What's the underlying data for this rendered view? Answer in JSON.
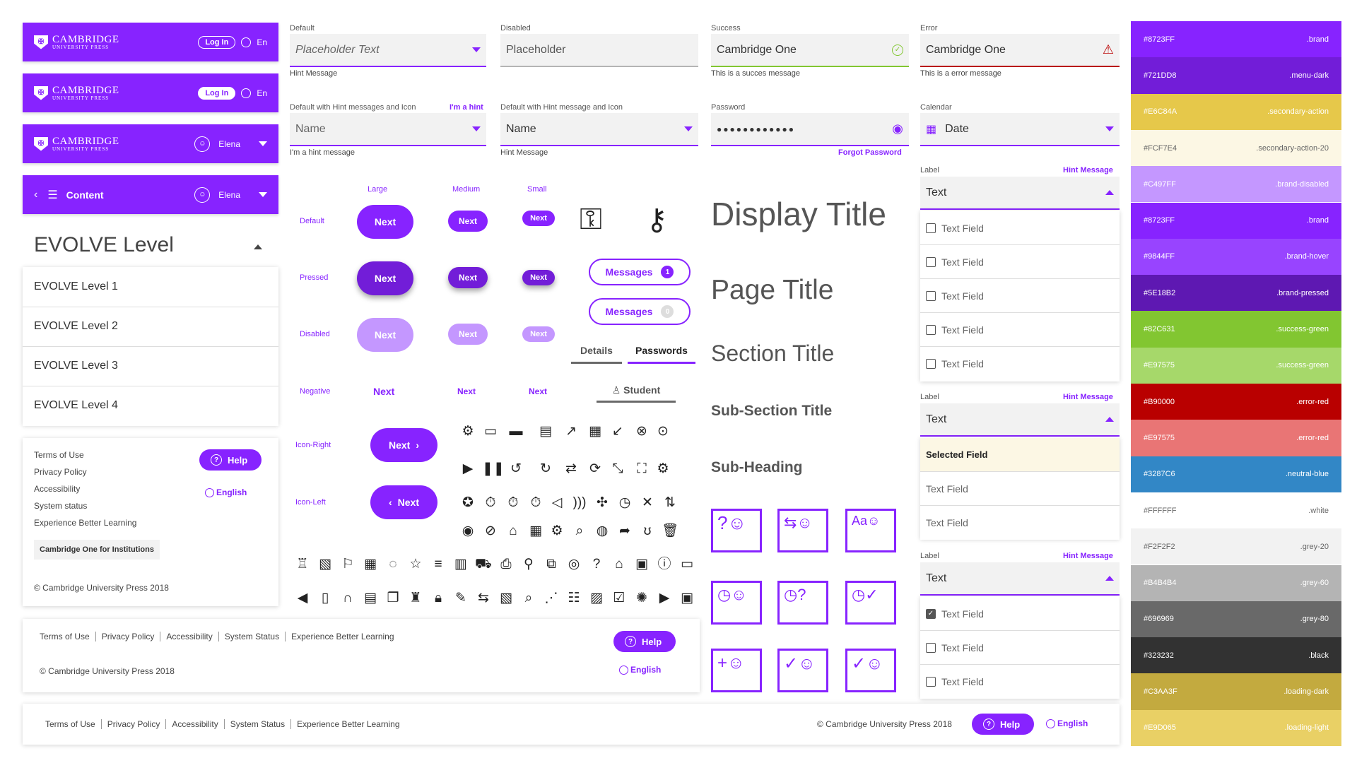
{
  "header1": {
    "logo_line1": "CAMBRIDGE",
    "logo_line2": "UNIVERSITY PRESS",
    "login": "Log In",
    "lang": "En"
  },
  "header2": {
    "logo_line1": "CAMBRIDGE",
    "logo_line2": "UNIVERSITY PRESS",
    "login": "Log In",
    "lang": "En"
  },
  "header3": {
    "logo_line1": "CAMBRIDGE",
    "logo_line2": "UNIVERSITY PRESS",
    "user": "Elena"
  },
  "header4": {
    "title": "Content",
    "user": "Elena"
  },
  "evolve": {
    "title": "EVOLVE Level",
    "items": [
      "EVOLVE Level 1",
      "EVOLVE Level 2",
      "EVOLVE Level 3",
      "EVOLVE Level 4"
    ]
  },
  "footer_card": {
    "links": [
      "Terms of Use",
      "Privacy Policy",
      "Accessibility",
      "System status",
      "Experience Better Learning"
    ],
    "institutions": "Cambridge One for Institutions",
    "copyright": "© Cambridge University Press 2018",
    "help": "Help",
    "lang": "English"
  },
  "footer_mid": {
    "links": [
      "Terms of Use",
      "Privacy Policy",
      "Accessibility",
      "System Status",
      "Experience Better Learning"
    ],
    "copyright": "© Cambridge University Press 2018",
    "help": "Help",
    "lang": "English"
  },
  "footer_wide": {
    "links": [
      "Terms of Use",
      "Privacy Policy",
      "Accessibility",
      "System Status",
      "Experience Better Learning"
    ],
    "copyright": "© Cambridge University Press 2018",
    "help": "Help",
    "lang": "English"
  },
  "fields": {
    "default": {
      "label": "Default",
      "placeholder": "Placeholder Text",
      "hint": "Hint Message"
    },
    "disabled": {
      "label": "Disabled",
      "value": "Placeholder"
    },
    "success": {
      "label": "Success",
      "value": "Cambridge One",
      "hint": "This is a succes message"
    },
    "error": {
      "label": "Error",
      "value": "Cambridge One",
      "hint": "This is a error message"
    },
    "hint_icon": {
      "label": "Default with Hint messages and Icon",
      "label_hint": "I'm a hint",
      "value": "Name",
      "hint": "I'm a hint message"
    },
    "hint_msg": {
      "label": "Default with Hint message and Icon",
      "value": "Name",
      "hint": "Hint Message"
    },
    "password": {
      "label": "Password",
      "value": "●●●●●●●●●●●●",
      "forgot": "Forgot Password"
    },
    "calendar": {
      "label": "Calendar",
      "value": "Date"
    }
  },
  "button_matrix": {
    "cols": [
      "Large",
      "Medium",
      "Small"
    ],
    "rows": [
      "Default",
      "Pressed",
      "Disabled",
      "Negative",
      "Icon-Right",
      "Icon-Left"
    ],
    "label": "Next"
  },
  "messages": [
    {
      "label": "Messages",
      "count": "1"
    },
    {
      "label": "Messages",
      "count": "0"
    }
  ],
  "tabs": [
    "Details",
    "Passwords"
  ],
  "student_tab": "Student",
  "typography": {
    "display": "Display Title",
    "page": "Page Title",
    "section": "Section Title",
    "subsection": "Sub-Section Title",
    "subheading": "Sub-Heading"
  },
  "list1": {
    "label": "Label",
    "hint": "Hint Message",
    "value": "Text",
    "items": [
      "Text Field",
      "Text Field",
      "Text Field",
      "Text Field",
      "Text Field"
    ]
  },
  "list2": {
    "label": "Label",
    "hint": "Hint Message",
    "value": "Text",
    "selected": "Selected Field",
    "items": [
      "Text Field",
      "Text Field"
    ]
  },
  "list3": {
    "label": "Label",
    "hint": "Hint Message",
    "value": "Text",
    "items": [
      "Text Field",
      "Text Field",
      "Text Field"
    ],
    "checked": [
      true,
      false,
      false
    ]
  },
  "colors": [
    {
      "hex": "#8723FF",
      "name": ".brand",
      "text": "light"
    },
    {
      "hex": "#721DD8",
      "name": ".menu-dark",
      "text": "light"
    },
    {
      "hex": "#E6C84A",
      "name": ".secondary-action",
      "text": "light"
    },
    {
      "hex": "#FCF7E4",
      "name": ".secondary-action-20",
      "text": "dark"
    },
    {
      "hex": "#C497FF",
      "name": ".brand-disabled",
      "text": "light"
    },
    {
      "hex": "#8723FF",
      "name": ".brand",
      "text": "light"
    },
    {
      "hex": "#9844FF",
      "name": ".brand-hover",
      "text": "light"
    },
    {
      "hex": "#5E18B2",
      "name": ".brand-pressed",
      "text": "light"
    },
    {
      "hex": "#82C631",
      "name": ".success-green",
      "text": "light"
    },
    {
      "hex": "#E97575",
      "name": ".success-green",
      "text": "light"
    },
    {
      "hex": "#B90000",
      "name": ".error-red",
      "text": "light"
    },
    {
      "hex": "#E97575",
      "name": ".error-red",
      "text": "light"
    },
    {
      "hex": "#3287C6",
      "name": ".neutral-blue",
      "text": "light"
    },
    {
      "hex": "#FFFFFF",
      "name": ".white",
      "text": "dark"
    },
    {
      "hex": "#F2F2F2",
      "name": ".grey-20",
      "text": "dark"
    },
    {
      "hex": "#B4B4B4",
      "name": ".grey-60",
      "text": "light"
    },
    {
      "hex": "#696969",
      "name": ".grey-80",
      "text": "light"
    },
    {
      "hex": "#323232",
      "name": ".black",
      "text": "light"
    },
    {
      "hex": "#C3AA3F",
      "name": ".loading-dark",
      "text": "light"
    },
    {
      "hex": "#E9D065",
      "name": ".loading-light",
      "text": "light"
    }
  ],
  "swatch_bg": [
    "#8723FF",
    "#721DD8",
    "#E6C84A",
    "#FCF7E4",
    "#C497FF",
    "#8723FF",
    "#9844FF",
    "#5E18B2",
    "#82C631",
    "#A6D86A",
    "#B90000",
    "#E97575",
    "#3287C6",
    "#FFFFFF",
    "#F2F2F2",
    "#B4B4B4",
    "#696969",
    "#323232",
    "#C3AA3F",
    "#E9D065"
  ]
}
